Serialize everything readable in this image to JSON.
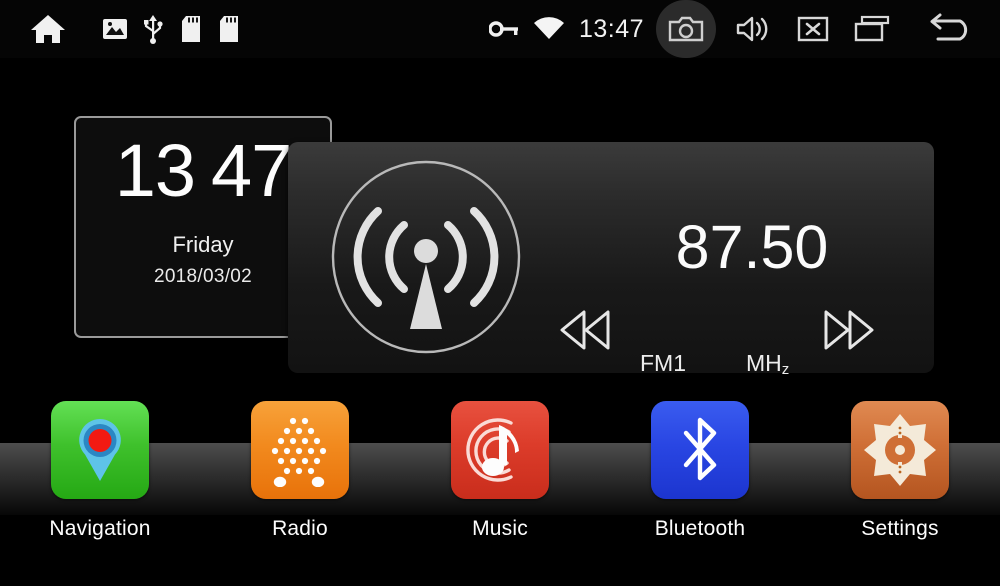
{
  "statusbar": {
    "left_icons": [
      {
        "name": "home-icon",
        "glyph": "home"
      },
      {
        "name": "gallery-icon",
        "glyph": "picture"
      },
      {
        "name": "usb-icon",
        "glyph": "usb"
      },
      {
        "name": "sd-card-1-icon",
        "glyph": "sdcard"
      },
      {
        "name": "sd-card-2-icon",
        "glyph": "sdcard"
      }
    ],
    "right_icons": [
      {
        "name": "vpn-key-icon",
        "glyph": "key"
      },
      {
        "name": "wifi-icon",
        "glyph": "wifi"
      }
    ],
    "clock": "13:47",
    "action_icons": [
      {
        "name": "screenshot-camera-icon",
        "glyph": "camera",
        "active": true
      },
      {
        "name": "volume-icon",
        "glyph": "speaker"
      },
      {
        "name": "close-app-icon",
        "glyph": "x-box"
      },
      {
        "name": "recent-apps-icon",
        "glyph": "recents"
      },
      {
        "name": "back-icon",
        "glyph": "back-arrow"
      }
    ]
  },
  "clock_widget": {
    "hours": "13",
    "minutes": "47",
    "weekday": "Friday",
    "date": "2018/03/02"
  },
  "radio_widget": {
    "icon_name": "radio-tower-icon",
    "frequency": "87.50",
    "band": "FM1",
    "unit_main": "MH",
    "unit_sub": "z",
    "prev_label": "seek-down",
    "next_label": "seek-up"
  },
  "dock": {
    "items": [
      {
        "label": "Navigation",
        "icon": "navigation-pin-icon",
        "color": "#3fc12c"
      },
      {
        "label": "Radio",
        "icon": "radio-grille-icon",
        "color": "#f28a1e"
      },
      {
        "label": "Music",
        "icon": "music-note-icon",
        "color": "#dc3c2a"
      },
      {
        "label": "Bluetooth",
        "icon": "bluetooth-icon",
        "color": "#2946e3"
      },
      {
        "label": "Settings",
        "icon": "settings-gear-icon",
        "color": "#cf6f36"
      }
    ]
  },
  "theme": {
    "background": "#000000",
    "statusbar_bg": "#050505",
    "text": "#fdfdfd",
    "widget_border": "#9a9a9a"
  }
}
